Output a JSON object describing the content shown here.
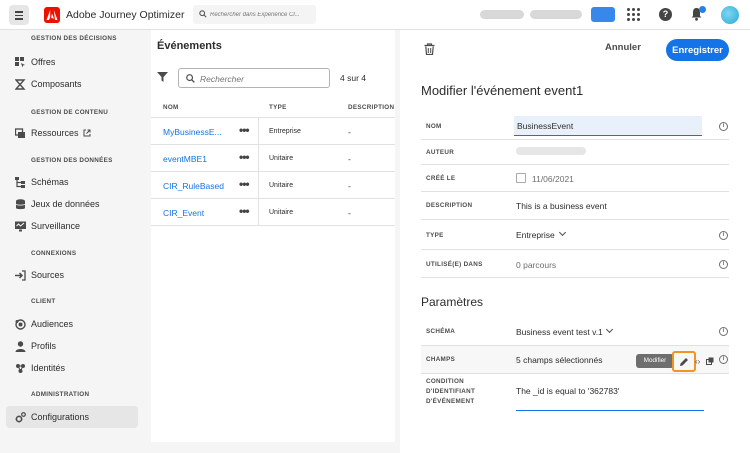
{
  "header": {
    "app_title": "Adobe Journey Optimizer",
    "search_placeholder": "Rechercher dans Experience Cl..."
  },
  "sidebar": {
    "sections": [
      {
        "title": "GESTION DES DÉCISIONS",
        "items": [
          {
            "label": "Offres",
            "icon": "offers-icon"
          },
          {
            "label": "Composants",
            "icon": "components-icon"
          }
        ]
      },
      {
        "title": "GESTION DE CONTENU",
        "items": [
          {
            "label": "Ressources",
            "icon": "assets-icon",
            "external": true
          }
        ]
      },
      {
        "title": "GESTION DES DONNÉES",
        "items": [
          {
            "label": "Schémas",
            "icon": "schema-icon"
          },
          {
            "label": "Jeux de données",
            "icon": "datasets-icon"
          },
          {
            "label": "Surveillance",
            "icon": "monitoring-icon"
          }
        ]
      },
      {
        "title": "CONNEXIONS",
        "items": [
          {
            "label": "Sources",
            "icon": "sources-icon"
          }
        ]
      },
      {
        "title": "CLIENT",
        "items": [
          {
            "label": "Audiences",
            "icon": "audiences-icon"
          },
          {
            "label": "Profils",
            "icon": "profile-icon"
          },
          {
            "label": "Identités",
            "icon": "identities-icon"
          }
        ]
      },
      {
        "title": "ADMINISTRATION",
        "items": [
          {
            "label": "Configurations",
            "icon": "gear-icon",
            "active": true
          }
        ]
      }
    ]
  },
  "events_panel": {
    "title": "Événements",
    "search_placeholder": "Rechercher",
    "count": "4 sur 4",
    "columns": [
      "NOM",
      "TYPE",
      "DESCRIPTION"
    ],
    "rows": [
      {
        "name": "MyBusinessE...",
        "more": "•••",
        "type": "Entreprise",
        "description": "-"
      },
      {
        "name": "eventMBE1",
        "more": "•••",
        "type": "Unitaire",
        "description": "-"
      },
      {
        "name": "CIR_RuleBased",
        "more": "•••",
        "type": "Unitaire",
        "description": "-"
      },
      {
        "name": "CIR_Event",
        "more": "•••",
        "type": "Unitaire",
        "description": "-"
      }
    ]
  },
  "editor": {
    "cancel_label": "Annuler",
    "save_label": "Enregistrer",
    "title": "Modifier l'événement event1",
    "fields": {
      "name_label": "NOM",
      "name_value": "BusinessEvent",
      "author_label": "AUTEUR",
      "created_label": "CRÉÉ LE",
      "created_value": "11/06/2021",
      "description_label": "DESCRIPTION",
      "description_value": "This is a business event",
      "type_label": "TYPE",
      "type_value": "Entreprise",
      "used_in_label": "UTILISÉ(E) DANS",
      "used_in_value": "0 parcours"
    },
    "params_title": "Paramètres",
    "params": {
      "schema_label": "SCHÉMA",
      "schema_value": "Business event test v.1",
      "fields_label": "CHAMPS",
      "fields_value": "5 champs sélectionnés",
      "condition_label_1": "CONDITION",
      "condition_label_2": "D'IDENTIFIANT",
      "condition_label_3": "D'ÉVÉNEMENT",
      "condition_value": "The _id is equal to '362783'"
    },
    "tooltip": "Modifier"
  },
  "colors": {
    "accent": "#1473e6",
    "highlight": "#f29423",
    "brand": "#eb1000"
  }
}
